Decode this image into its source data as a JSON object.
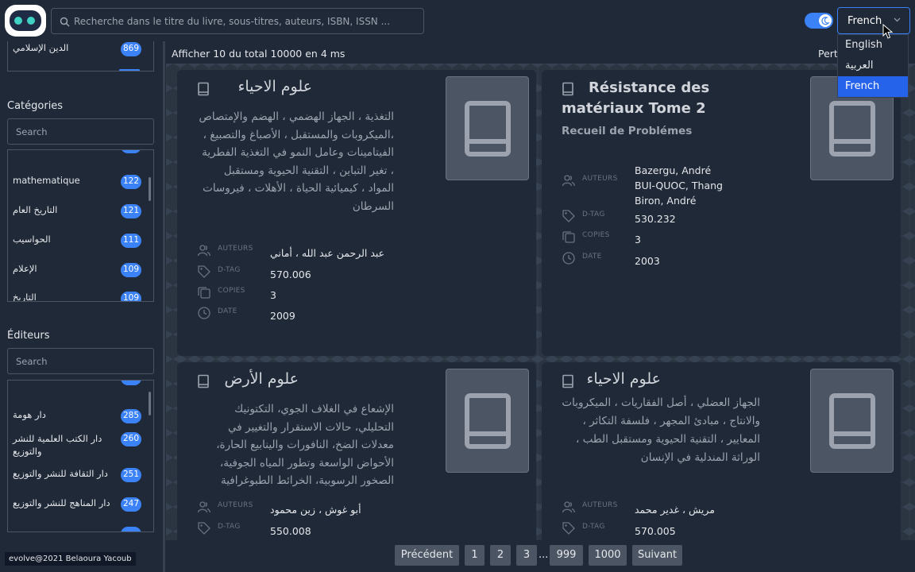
{
  "header": {
    "search_placeholder": "Recherche dans le titre du livre, sous-titres, auteurs, ISBN, ISSN ...",
    "language": "French",
    "language_options": [
      "English",
      "العربية",
      "French"
    ]
  },
  "sidebar": {
    "top_list": [
      {
        "label": "الدين الإسلامي",
        "count": "869"
      }
    ],
    "categories_heading": "Catégories",
    "categories_search_placeholder": "Search",
    "categories": [
      {
        "label": "mathematique",
        "count": "122"
      },
      {
        "label": "التاريخ العام",
        "count": "121"
      },
      {
        "label": "الحواسيب",
        "count": "111"
      },
      {
        "label": "الإعلام",
        "count": "109"
      },
      {
        "label": "التاريخ",
        "count": "109"
      }
    ],
    "editors_heading": "Éditeurs",
    "editors_search_placeholder": "Search",
    "editors": [
      {
        "label": "دار هومة",
        "count": "285"
      },
      {
        "label": "دار الكتب العلمية للنشر والتوزيع",
        "count": "260"
      },
      {
        "label": "دار الثقافة للنشر والتوزيع",
        "count": "251"
      },
      {
        "label": "دار المناهج للنشر والتوزيع",
        "count": "247"
      }
    ],
    "credit": "evolve@2021 Belaoura Yacoub"
  },
  "main": {
    "summary": "Afficher 10 du total 10000 en 4 ms",
    "sort_partial": "Pert",
    "labels": {
      "authors": "AUTEURS",
      "dtag": "D-TAG",
      "copies": "COPIES",
      "date": "DATE"
    },
    "cards": [
      {
        "title": "علوم الاحياء",
        "description": "التغذية ، الجهاز الهضمي ، الهضم والإمتصاص ،الميكروبات والمستقبل ، الأصباغ والتصبيغ ، الفيتامينات وعامل النمو في التغذية الفطرية ، تغير التباين ، التقنية الحيوية ومستقبل المواد ، كيميائية الحياة ، الأهلات ، فيروسات السرطان",
        "authors": "عبد الرحمن عبد الله ، أماني",
        "dtag": "570.006",
        "copies": "3",
        "date": "2009"
      },
      {
        "title": "Résistance des matériaux Tome 2",
        "subtitle": "Recueil de Problémes",
        "authors": [
          "Bazergu, André",
          "BUI-QUOC, Thang",
          "Biron, André"
        ],
        "dtag": "530.232",
        "copies": "3",
        "date": "2003"
      },
      {
        "title": "علوم الأرض",
        "description": "الإشعاع في الغلاف الجوي، التكتونيك التحليلي، حالات الاستقرار والتغيير في معدلات الضخ، النافورات والينابيع الحارة، الأحواض الواسعة وتطور المياه الجوفية، الصخور الرسوبية، الخرائط الطبوغرافية",
        "authors": "أبو غوش ، زين محمود",
        "dtag": "550.008"
      },
      {
        "title": "علوم الاحياء",
        "description": "الجهاز العضلي ، أصل الفقاريات ، الميكروبات والانتاج ، مبادئ المجهر ، فلسفة التكاثر ، المعايير ، التقنية الحيوية ومستقبل الطب ، الوراثة المندلية في الإنسان",
        "authors": "مريش ، غدير محمد",
        "dtag": "570.005"
      }
    ]
  },
  "pagination": {
    "prev": "Précédent",
    "pages": [
      "1",
      "2",
      "3",
      "999",
      "1000"
    ],
    "ellipsis": "...",
    "next": "Suivant"
  }
}
